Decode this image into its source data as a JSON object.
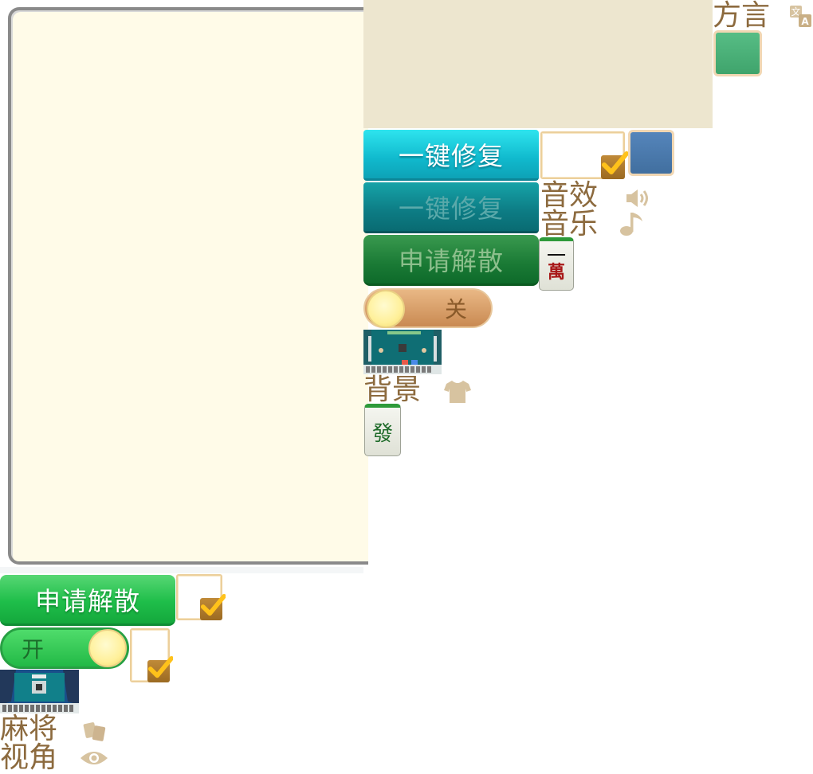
{
  "labels": {
    "dialect": "方言",
    "sound_effect": "音效",
    "music": "音乐",
    "background": "背景",
    "mahjong": "麻将",
    "view_angle": "视角"
  },
  "buttons": {
    "repair_active": "一键修复",
    "repair_pressed": "一键修复",
    "dissolve_pressed": "申请解散",
    "dissolve_normal": "申请解散"
  },
  "toggles": {
    "off_text": "关",
    "on_text": "开"
  },
  "tiles": {
    "wan_top": "一",
    "wan_bottom": "萬",
    "fa": "發"
  },
  "colors": {
    "label_brown": "#8c6a3e",
    "icon_tan": "#cdb48f",
    "swatch_green": "#4db07a",
    "swatch_blue": "#4a78ad"
  },
  "icons": [
    "translate-icon",
    "speaker-icon",
    "music-note-icon",
    "shirt-icon",
    "cards-icon",
    "eye-icon"
  ]
}
